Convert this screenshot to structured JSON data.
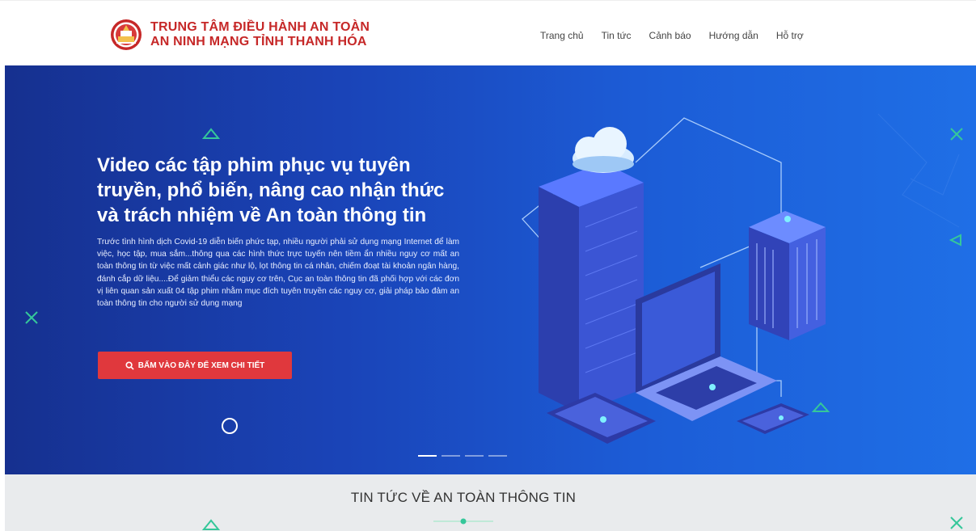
{
  "header": {
    "logo_line1": "TRUNG TÂM ĐIỀU HÀNH AN TOÀN",
    "logo_line2": "AN NINH MẠNG TỈNH THANH HÓA",
    "nav": [
      "Trang chủ",
      "Tin tức",
      "Cảnh báo",
      "Hướng dẫn",
      "Hỗ trợ"
    ]
  },
  "hero": {
    "title": "Video các tập phim phục vụ tuyên truyền, phổ biến, nâng cao nhận thức và trách nhiệm về An toàn thông tin",
    "description": "Trước tình hình dịch Covid-19 diễn biến phức tạp, nhiều người phải sử dụng mạng Internet để làm việc, học tập, mua sắm...thông qua các hình thức trực tuyến nên tiềm ẩn nhiều nguy cơ mất an toàn thông tin từ việc mất cảnh giác như lộ, lọt thông tin cá nhân, chiếm đoạt tài khoản ngân hàng, đánh cắp dữ liệu....Để giảm thiểu các nguy cơ trên, Cục an toàn thông tin đã phối hợp với các đơn vị liên quan sản xuất 04 tập phim nhằm mục đích tuyên truyền các nguy cơ, giải pháp bảo đảm an toàn thông tin cho người sử dụng mạng",
    "button_label": "BẤM VÀO ĐÂY ĐỂ XEM CHI TIẾT",
    "slides_total": 4,
    "active_slide": 1
  },
  "news": {
    "title": "TIN TỨC VỀ AN TOÀN THÔNG TIN"
  },
  "colors": {
    "brand_red": "#c62828",
    "button_red": "#e0383d",
    "hero_blue": "#1a44b8",
    "accent_green": "#35c79a"
  },
  "icons": [
    "emblem-logo",
    "search-icon",
    "triangle-deco",
    "cross-deco",
    "circle-deco"
  ]
}
